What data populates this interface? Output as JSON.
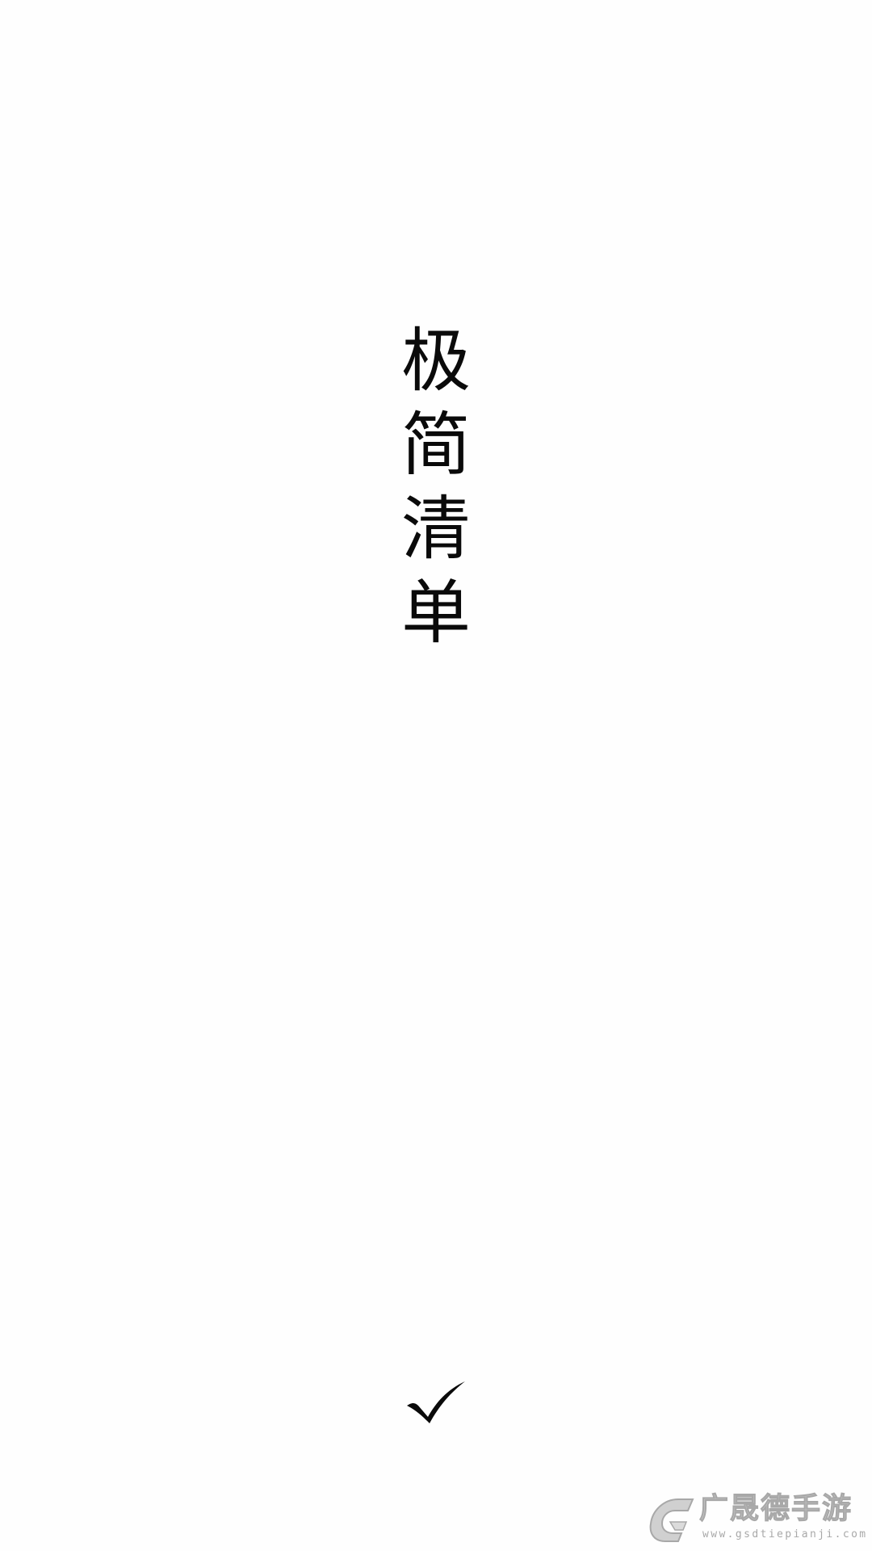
{
  "splash": {
    "title_chars": [
      "极",
      "简",
      "清",
      "单"
    ]
  },
  "actions": {
    "confirm_icon": "checkmark-icon"
  },
  "watermark": {
    "name": "广晟德手游",
    "url": "www.gsdtiepianji.com",
    "logo_icon": "gsd-logo-icon"
  },
  "colors": {
    "background": "#fefefe",
    "text": "#0a0a0a",
    "watermark": "#bdbdbd"
  }
}
